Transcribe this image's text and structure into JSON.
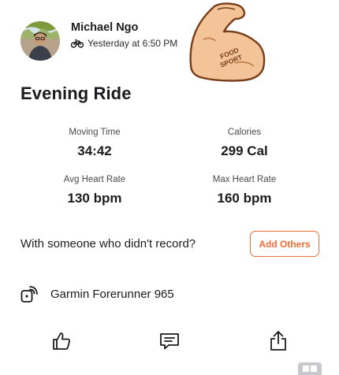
{
  "athlete": {
    "name": "Michael Ngo",
    "timestamp": "Yesterday at 6:50 PM"
  },
  "sticker": {
    "text_line1": "FOOD",
    "text_line2": "SPORT"
  },
  "activity": {
    "title": "Evening Ride"
  },
  "stats": [
    {
      "label": "Moving Time",
      "value": "34:42"
    },
    {
      "label": "Calories",
      "value": "299 Cal"
    },
    {
      "label": "Avg Heart Rate",
      "value": "130 bpm"
    },
    {
      "label": "Max Heart Rate",
      "value": "160 bpm"
    }
  ],
  "tagging": {
    "prompt": "With someone who didn't record?",
    "button_label": "Add Others"
  },
  "device": {
    "name": "Garmin Forerunner 965"
  },
  "icons": {
    "activity_type": "bicycle-icon",
    "device": "watch-sync-icon",
    "kudos": "thumbs-up-icon",
    "comment": "comment-icon",
    "share": "share-icon"
  },
  "colors": {
    "accent": "#f26c35",
    "text": "#1b1b1f"
  }
}
